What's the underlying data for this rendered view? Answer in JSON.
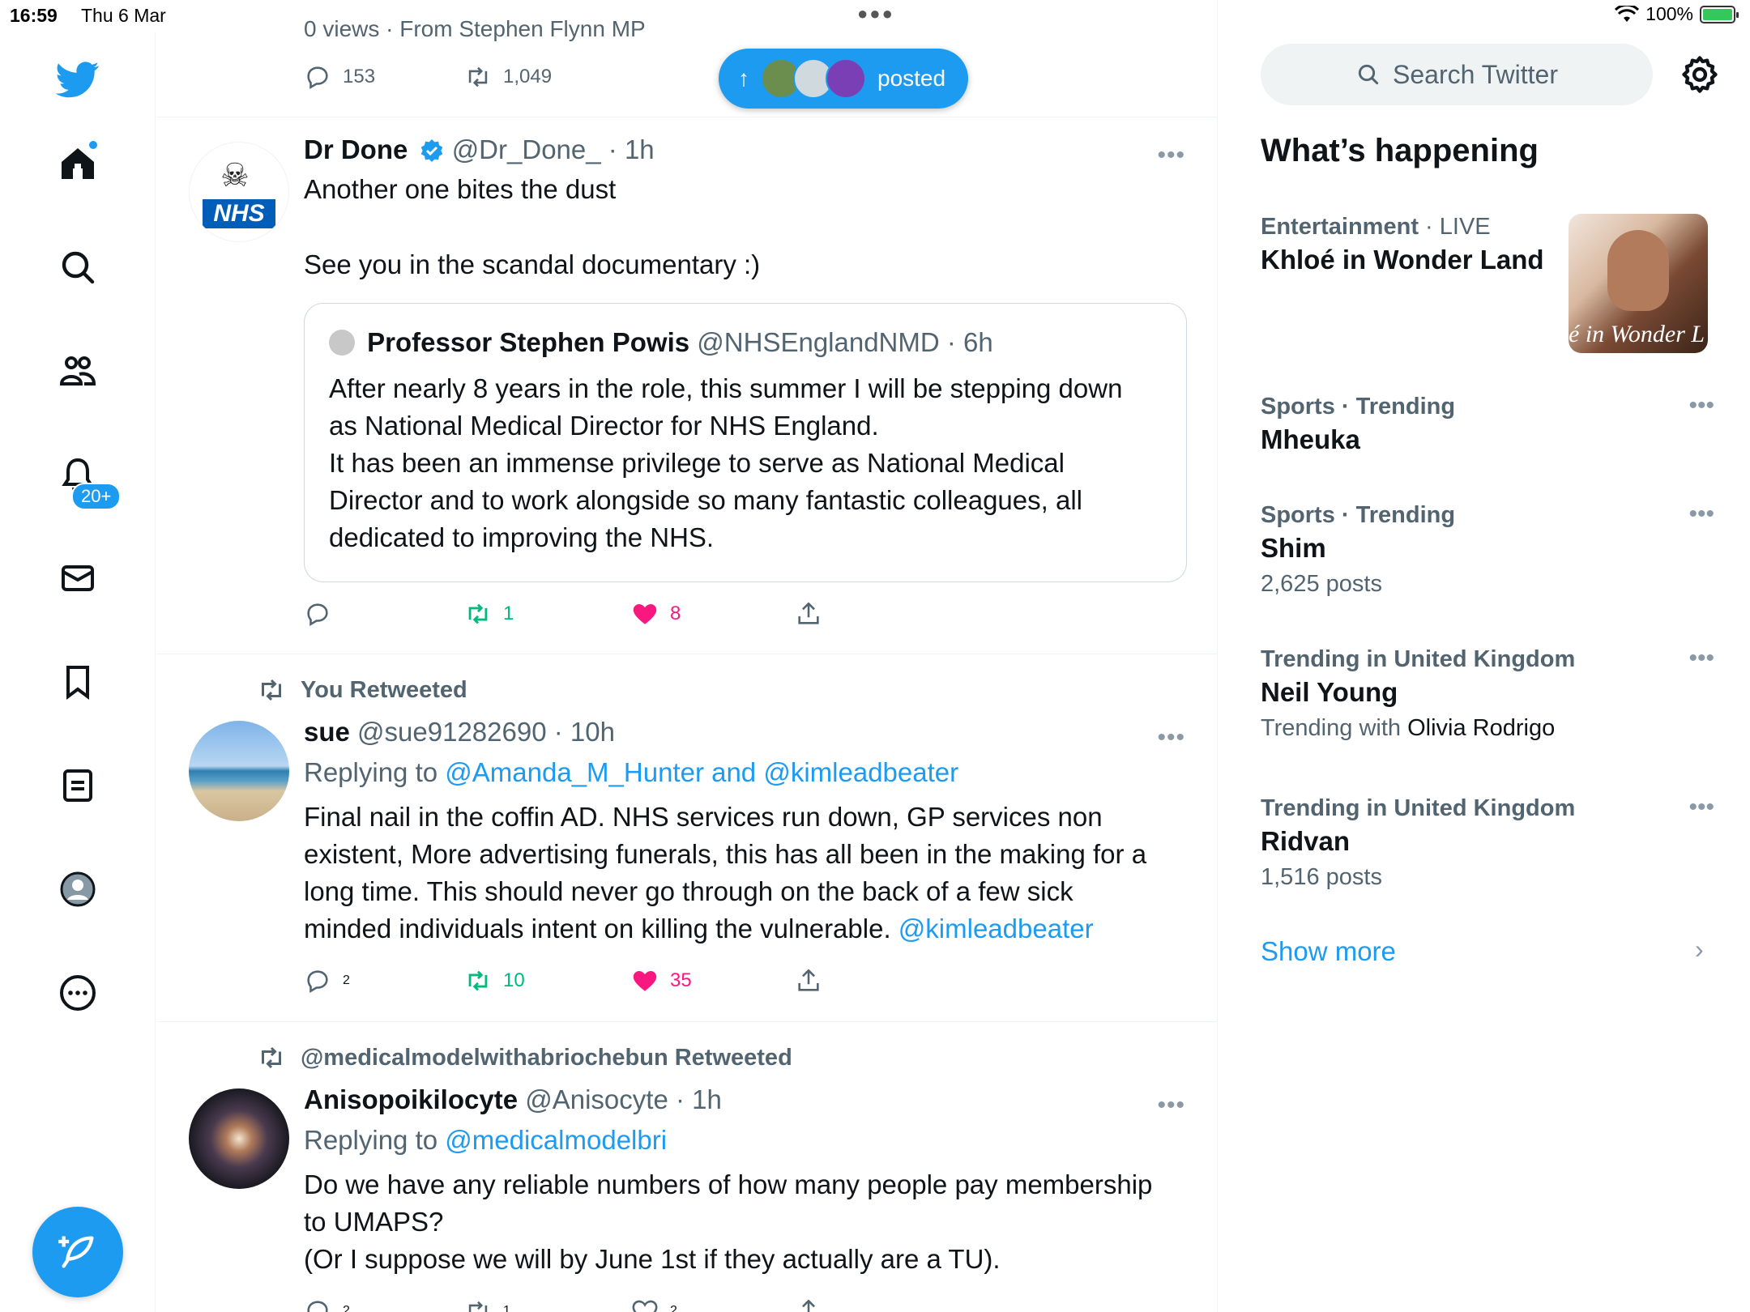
{
  "status_bar": {
    "time": "16:59",
    "date": "Thu 6 Mar",
    "battery": "100%"
  },
  "nav": {
    "notifications_badge": "20+"
  },
  "posted_pill": {
    "label": "posted"
  },
  "top_tweet": {
    "partial_text": "0 views · From Stephen Flynn MP",
    "replies": "153",
    "retweets": "1,049"
  },
  "tweets": [
    {
      "name": "Dr Done",
      "handle": "@Dr_Done_",
      "time": "· 1h",
      "avatar_text": "NHS",
      "text_lines": [
        "Another one bites the dust",
        "See you in the scandal documentary :)"
      ],
      "quote": {
        "name": "Professor Stephen Powis",
        "handle": "@NHSEnglandNMD",
        "time": "· 6h",
        "text_lines": [
          "After nearly 8 years in the role, this summer I will be stepping down",
          "as National Medical Director for NHS England.",
          "It has been an immense privilege to serve as National Medical",
          "Director and to work alongside so many fantastic colleagues, all",
          "dedicated to improving the NHS."
        ]
      },
      "retweets": "1",
      "likes": "8"
    },
    {
      "retweeted_by": "You Retweeted",
      "name": "sue",
      "handle": "@sue91282690",
      "time": "· 10h",
      "replying_prefix": "Replying to",
      "replying_to": "@Amanda_M_Hunter and @kimleadbeater",
      "text_lines": [
        "Final nail in the coffin AD. NHS services run down, GP services non",
        "existent, More advertising  funerals, this has all been in the making for a",
        "long time.  This should never go through on the back of a few sick"
      ],
      "last_line": "minded individuals intent on killing the vulnerable.",
      "last_mention": "@kimleadbeater",
      "replies": "2",
      "retweets": "10",
      "likes": "35"
    },
    {
      "retweeted_by": "@medicalmodelwithabriochebun Retweeted",
      "name": "Anisopoikilocyte",
      "handle": "@Anisocyte",
      "time": "· 1h",
      "replying_prefix": "Replying to",
      "replying_to": "@medicalmodelbri",
      "text_lines": [
        "Do we have any reliable numbers of how many people pay membership",
        "to UMAPS?",
        "(Or I suppose we will by June 1st if they actually are a TU)."
      ],
      "replies": "2",
      "retweets": "1",
      "likes": "2"
    }
  ],
  "sidebar": {
    "search_placeholder": "Search Twitter",
    "title": "What’s happening",
    "trends": [
      {
        "category": "Entertainment",
        "meta_suffix": " · LIVE",
        "title": "Khloé in Wonder Land",
        "image_text": "é in Wonder L"
      },
      {
        "category": "Sports · Trending",
        "title": "Mheuka"
      },
      {
        "category": "Sports · Trending",
        "title": "Shim",
        "sub": "2,625 posts"
      },
      {
        "category": "Trending in United Kingdom",
        "title": "Neil Young",
        "sub_prefix": "Trending with ",
        "sub_dark": "Olivia Rodrigo"
      },
      {
        "category": "Trending in United Kingdom",
        "title": "Ridvan",
        "sub": "1,516 posts"
      }
    ],
    "show_more": "Show more"
  },
  "colors": {
    "accent": "#1d9bf0",
    "retweet": "#00ba7c",
    "like": "#f91880",
    "secondary_text": "#536471"
  }
}
